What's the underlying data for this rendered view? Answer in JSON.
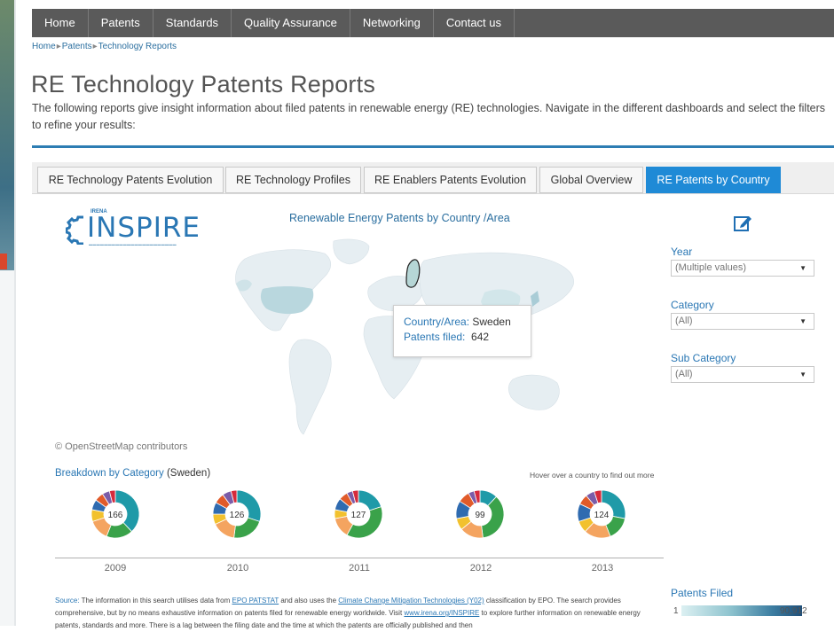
{
  "nav": {
    "items": [
      "Home",
      "Patents",
      "Standards",
      "Quality Assurance",
      "Networking",
      "Contact us"
    ]
  },
  "breadcrumb": [
    "Home",
    "Patents",
    "Technology Reports"
  ],
  "page": {
    "title": "RE Technology Patents Reports",
    "intro": "The following reports give insight information about filed patents in renewable energy (RE) technologies. Navigate in the different dashboards and select the filters to refine your results:"
  },
  "tabs": [
    {
      "label": "RE Technology Patents Evolution",
      "active": false
    },
    {
      "label": "RE Technology Profiles",
      "active": false
    },
    {
      "label": "RE Enablers Patents Evolution",
      "active": false
    },
    {
      "label": "Global Overview",
      "active": false
    },
    {
      "label": "RE Patents by Country",
      "active": true
    }
  ],
  "logo": {
    "text": "INSPIRE",
    "small": "IRENA"
  },
  "map": {
    "title": "Renewable Energy  Patents by Country /Area",
    "attribution": "© OpenStreetMap contributors",
    "tooltip": {
      "country_label": "Country/Area:",
      "country_value": "Sweden",
      "patents_label": "Patents filed:",
      "patents_value": "642"
    }
  },
  "filters": {
    "year": {
      "label": "Year",
      "value": "(Multiple values)"
    },
    "category": {
      "label": "Category",
      "value": "(All)"
    },
    "subcategory": {
      "label": "Sub Category",
      "value": "(All)"
    }
  },
  "breakdown": {
    "title": "Breakdown by Category",
    "country": "(Sweden)",
    "hint": "Hover over a country to find out more",
    "years": [
      "2009",
      "2010",
      "2011",
      "2012",
      "2013"
    ],
    "totals": [
      "166",
      "126",
      "127",
      "99",
      "124"
    ],
    "palette": [
      "#1f9aa8",
      "#3aa24a",
      "#f4a460",
      "#f2c12e",
      "#2f6bb0",
      "#e15b2a",
      "#7a5ca8",
      "#d62b3c"
    ],
    "shares": [
      [
        0.38,
        0.18,
        0.14,
        0.08,
        0.07,
        0.06,
        0.05,
        0.04
      ],
      [
        0.3,
        0.22,
        0.16,
        0.07,
        0.08,
        0.07,
        0.06,
        0.04
      ],
      [
        0.2,
        0.38,
        0.14,
        0.06,
        0.08,
        0.06,
        0.04,
        0.04
      ],
      [
        0.12,
        0.36,
        0.16,
        0.08,
        0.12,
        0.08,
        0.04,
        0.04
      ],
      [
        0.28,
        0.16,
        0.18,
        0.08,
        0.12,
        0.07,
        0.06,
        0.05
      ]
    ]
  },
  "legend": {
    "title": "Patents Filed",
    "min": "1",
    "max": "90,912"
  },
  "source": {
    "label": "Source:",
    "text1": " The information in this search utilises data from ",
    "link1": "EPO PATSTAT",
    "text2": " and also uses the ",
    "link2": "Climate Change Mitigation Technologies (Y02)",
    "text3": " classification by EPO. The search provides comprehensive, but by no means exhaustive information on patents filed for renewable energy worldwide. Visit ",
    "link3": "www.irena.org/INSPIRE",
    "text4": " to explore further information on renewable energy patents, standards and more. There is a lag between the filing date and the time at which the patents are officially published and then"
  }
}
